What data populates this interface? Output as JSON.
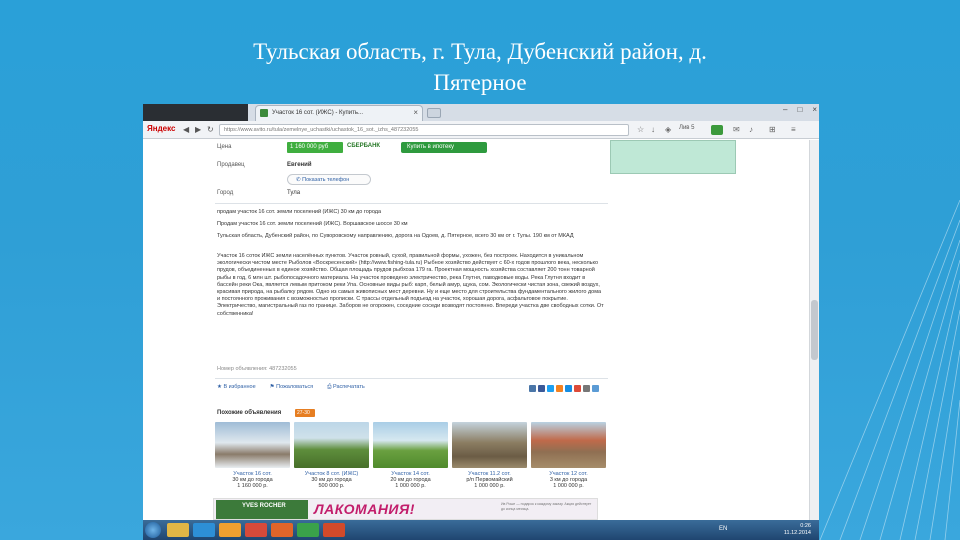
{
  "slide": {
    "title_line1": "Тульская область, г. Тула, Дубенский район, д.",
    "title_line2": "Пятерное"
  },
  "browser": {
    "tab_title": "Участок 16 сот. (ИЖС) - Купить...",
    "url": "https://www.avito.ru/tula/zemelnye_uchastki/uchastok_16_sot._izhs_487232055",
    "search_brand": "Яндекс",
    "weather": "Лив 5"
  },
  "listing": {
    "price_label": "Цена",
    "price_value": "1 160 000 руб",
    "sber_label": "СБЕРБАНК",
    "mortgage_button": "Купить в ипотеку",
    "seller_label": "Продавец",
    "seller_name": "Евгений",
    "phone_button": "Показать телефон",
    "city_label": "Город",
    "city_value": "Тула",
    "line1": "продам участок 16 сот. земли поселений (ИЖС) 30 км до города",
    "line2": "Продам участок 16 сот. земли поселений (ИЖС). Воршавское шоссе 30 км",
    "address": "Тульская область, Дубенский район, по Суворовскому направлению, дорога на Одоев, д. Пятерное, всего 30 км от г. Тулы. 190 км от МКАД",
    "description": "Участок 16 соток ИЖС земли населённых пунктов. Участок ровный, сухой, правильной формы, ухожен, без построек. Находится в уникальном экологически чистом месте Рыболов «Воскресенский» (http://www.fishing-tula.ru) Рыбное хозяйство действует с 60-х годов прошлого века, несколько прудов, объединенных в единое хозяйство. Общая площадь прудов рыбхоза 179 га. Проектная мощность хозяйства составляет 200 тонн товарной рыбы в год, 6 млн шт. рыбопосадочного материала. На участок проведено электричество, река Глутня, паводковые воды. Река Глутня входит в бассейн реки Ока, является левым притоком реки Упа. Основные виды рыб: карп, белый амур, щука, сом. Экологически чистая зона, свежий воздух, красивая природа, на рыбалку рядом. Одно из самых живописных мест деревни. Ну и еще место для строительства фундаментального жилого дома и постоянного проживания с возможностью прописки. С трассы отдельный подъезд на участок, хорошая дорога, асфальтовое покрытие. Электричество, магистральный газ по границе. Заборов не огорожен, соседние соседи возводят постоянно. Впереди участка две свободных сотки. От собственника!",
    "ad_number": "Номер объявления: 487232055",
    "action_favorite": "В избранное",
    "action_complain": "Пожаловаться",
    "action_print": "Распечатать",
    "similar_title": "Похожие объявления",
    "similar_badge": "27-30",
    "similar": [
      {
        "t1": "Участок 16 сот.",
        "t2": "30 км до города",
        "t3": "1 160 000 р."
      },
      {
        "t1": "Участок 8 сот. (ИЖС)",
        "t2": "30 км до города",
        "t3": "500 000 р."
      },
      {
        "t1": "Участок 14 сот.",
        "t2": "20 км до города",
        "t3": "1 000 000 р."
      },
      {
        "t1": "Участок 11.2 сот.",
        "t2": "р/п Первомайский",
        "t3": "1 000 000 р."
      },
      {
        "t1": "Участок 12 сот.",
        "t2": "3 км до города",
        "t3": "1 000 000 р."
      }
    ],
    "banner_brand": "YVES ROCHER",
    "banner_text": "ЛАКОМАНИЯ!",
    "banner_small": "Ив Роше — подарок к каждому заказу. Акция действует до конца месяца."
  },
  "taskbar": {
    "lang": "EN",
    "time": "0:26",
    "date": "11.12.2014"
  },
  "colors": {
    "slide_bg": "#2f9fd6",
    "price_green": "#3fae3f",
    "link_blue": "#3061a6",
    "banner_pink": "#c21d6b"
  }
}
